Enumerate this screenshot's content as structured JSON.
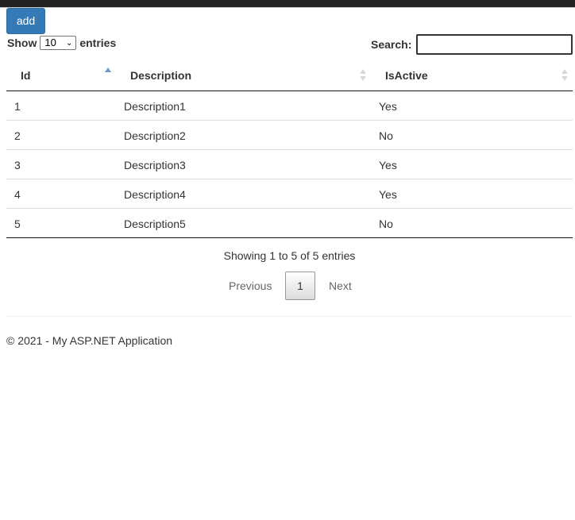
{
  "toolbar": {
    "add_label": "add"
  },
  "length": {
    "prefix": "Show",
    "value": "10",
    "suffix": "entries"
  },
  "search": {
    "label": "Search:",
    "value": ""
  },
  "table": {
    "columns": [
      "Id",
      "Description",
      "IsActive"
    ],
    "sorted_column": "Id",
    "sort_direction": "ascending",
    "rows": [
      {
        "id": "1",
        "description": "Description1",
        "active": "Yes"
      },
      {
        "id": "2",
        "description": "Description2",
        "active": "No"
      },
      {
        "id": "3",
        "description": "Description3",
        "active": "Yes"
      },
      {
        "id": "4",
        "description": "Description4",
        "active": "Yes"
      },
      {
        "id": "5",
        "description": "Description5",
        "active": "No"
      }
    ]
  },
  "info": "Showing 1 to 5 of 5 entries",
  "pagination": {
    "previous": "Previous",
    "current": "1",
    "next": "Next"
  },
  "footer": "© 2021 - My ASP.NET Application",
  "colors": {
    "accent": "#337ab7",
    "navbar": "#222222"
  }
}
